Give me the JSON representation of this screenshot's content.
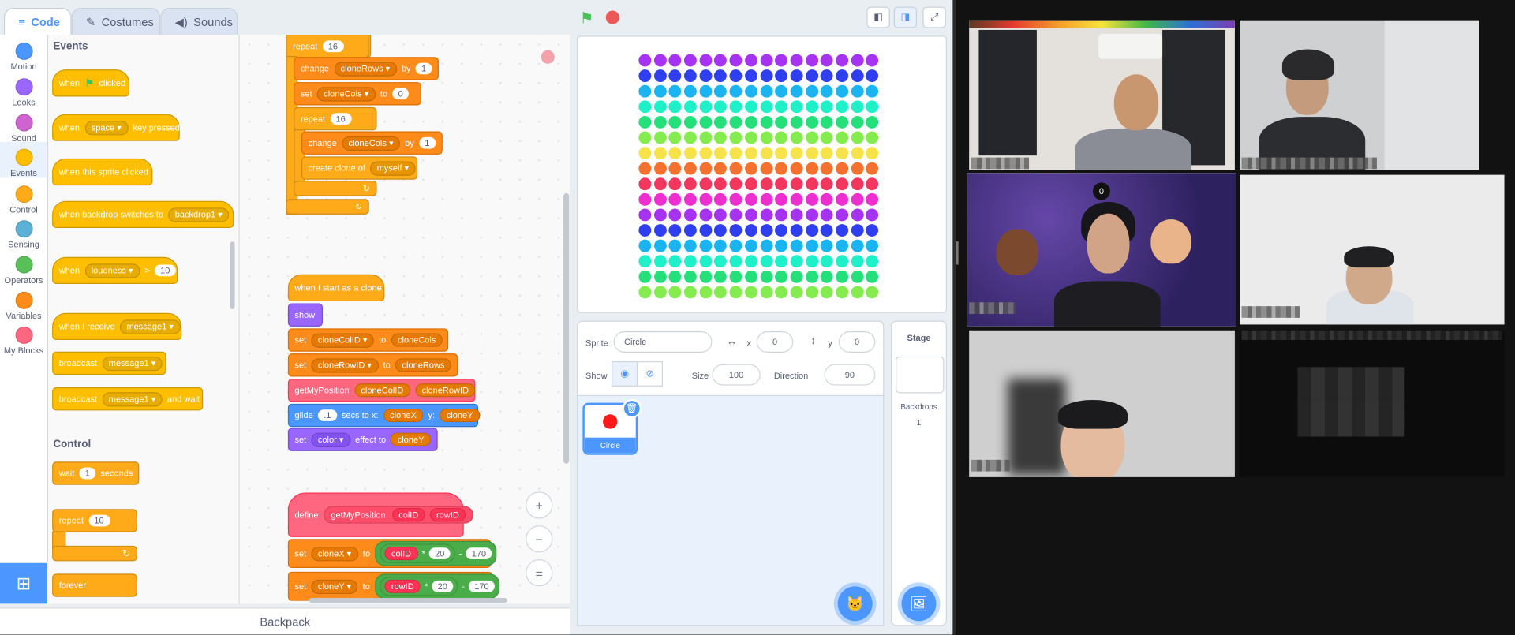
{
  "tabs": [
    {
      "label": "Code",
      "icon": "code-icon",
      "active": true
    },
    {
      "label": "Costumes",
      "icon": "brush-icon",
      "active": false
    },
    {
      "label": "Sounds",
      "icon": "speaker-icon",
      "active": false
    }
  ],
  "categories": [
    {
      "label": "Motion",
      "color": "#4c97ff"
    },
    {
      "label": "Looks",
      "color": "#9966ff"
    },
    {
      "label": "Sound",
      "color": "#cf63cf"
    },
    {
      "label": "Events",
      "color": "#ffbf00",
      "selected": true
    },
    {
      "label": "Control",
      "color": "#ffab19"
    },
    {
      "label": "Sensing",
      "color": "#5cb1d6"
    },
    {
      "label": "Operators",
      "color": "#59c059"
    },
    {
      "label": "Variables",
      "color": "#ff8c1a"
    },
    {
      "label": "My Blocks",
      "color": "#ff6680"
    }
  ],
  "palette": {
    "events_heading": "Events",
    "control_heading": "Control",
    "when_flag": {
      "pre": "when",
      "post": "clicked"
    },
    "when_key": {
      "pre": "when",
      "key": "space",
      "post": "key pressed"
    },
    "when_sprite_clicked": "when this sprite clicked",
    "when_backdrop": {
      "pre": "when backdrop switches to",
      "value": "backdrop1"
    },
    "when_loudness": {
      "pre": "when",
      "menu": "loudness",
      "op": ">",
      "value": "10"
    },
    "when_receive": {
      "pre": "when I receive",
      "value": "message1"
    },
    "broadcast": {
      "pre": "broadcast",
      "value": "message1"
    },
    "broadcast_wait": {
      "pre": "broadcast",
      "value": "message1",
      "post": "and wait"
    },
    "wait": {
      "pre": "wait",
      "value": "1",
      "post": "seconds"
    },
    "repeat": {
      "pre": "repeat",
      "value": "10"
    },
    "forever": "forever"
  },
  "script": {
    "repeat_outer": {
      "label": "repeat",
      "value": "16"
    },
    "change_rows": {
      "pre": "change",
      "var": "cloneRows",
      "by": "by",
      "value": "1"
    },
    "set_cols": {
      "pre": "set",
      "var": "cloneCols",
      "to": "to",
      "value": "0"
    },
    "repeat_inner": {
      "label": "repeat",
      "value": "16"
    },
    "change_cols": {
      "pre": "change",
      "var": "cloneCols",
      "by": "by",
      "value": "1"
    },
    "create_clone": {
      "pre": "create clone of",
      "value": "myself"
    },
    "clone_hat": "when I start as a clone",
    "show": "show",
    "set_col_id": {
      "pre": "set",
      "var": "cloneColID",
      "to": "to",
      "value": "cloneCols"
    },
    "set_row_id": {
      "pre": "set",
      "var": "cloneRowID",
      "to": "to",
      "value": "cloneRows"
    },
    "get_pos": {
      "name": "getMyPosition",
      "a": "cloneColID",
      "b": "cloneRowID"
    },
    "glide": {
      "pre": "glide",
      "secs": ".1",
      "mid": "secs to x:",
      "x": "cloneX",
      "ylbl": "y:",
      "y": "cloneY"
    },
    "set_effect": {
      "pre": "set",
      "menu": "color",
      "mid": "effect to",
      "value": "cloneY"
    },
    "define": {
      "pre": "define",
      "name": "getMyPosition",
      "a": "colID",
      "b": "rowID"
    },
    "set_x": {
      "pre": "set",
      "var": "cloneX",
      "to": "to",
      "arg": "colID",
      "mul": "*",
      "n1": "20",
      "minus": "-",
      "n2": "170"
    },
    "set_y": {
      "pre": "set",
      "var": "cloneY",
      "to": "to",
      "arg": "rowID",
      "mul": "*",
      "n1": "20",
      "minus": "-",
      "n2": "170"
    }
  },
  "zoom": {
    "in": "+",
    "out": "−",
    "reset": "="
  },
  "backpack": "Backpack",
  "stage_grid": {
    "columns": 16,
    "row_colors": [
      "#a632f2",
      "#2f3ff0",
      "#1ab5f0",
      "#1ef0c8",
      "#25e07a",
      "#84ec4e",
      "#f6e24a",
      "#f5712f",
      "#f2375f",
      "#ee2fd0",
      "#a632f2",
      "#2f3ff0",
      "#1ab5f0",
      "#1ef0c8",
      "#25e07a",
      "#84ec4e"
    ]
  },
  "sprite_info": {
    "sprite_label": "Sprite",
    "sprite_name": "Circle",
    "x_label": "x",
    "x": "0",
    "y_label": "y",
    "y": "0",
    "show_label": "Show",
    "size_label": "Size",
    "size": "100",
    "direction_label": "Direction",
    "direction": "90"
  },
  "sprites": [
    {
      "name": "Circle"
    }
  ],
  "stage_panel": {
    "title": "Stage",
    "backdrops_label": "Backdrops",
    "backdrops_count": "1"
  },
  "meeting": {
    "badge_text": "0"
  }
}
